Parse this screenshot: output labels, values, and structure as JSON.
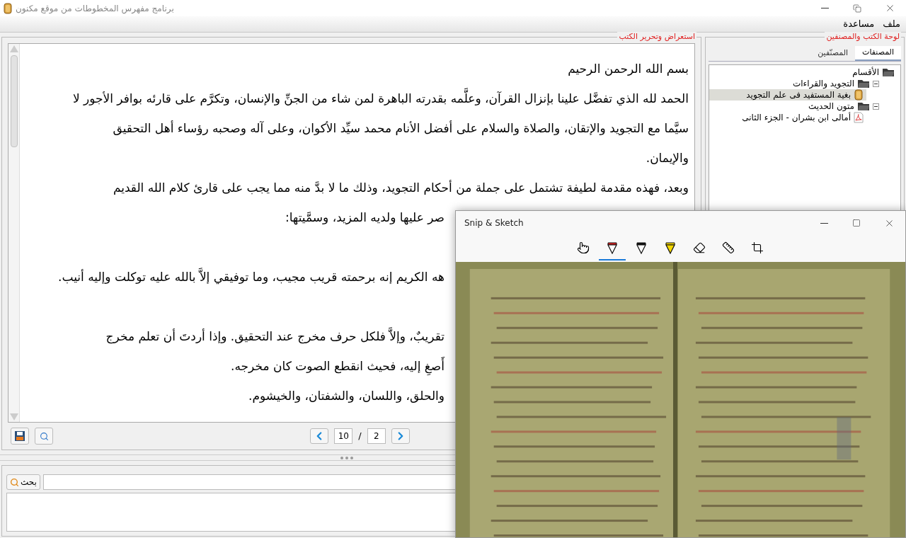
{
  "window": {
    "title": "برنامج مفهرس المخطوطات من موقع مكنون"
  },
  "menu": [
    "ملف",
    "مساعدة"
  ],
  "editor": {
    "title": "استعراض وتحرير الكتب",
    "lines": [
      {
        "kind": "line",
        "text": "بسم الله الرحمن الرحيم"
      },
      {
        "kind": "line",
        "text": "الحمد لله الذي تفضَّل علينا بإنزال القرآن، وعلَّمه بقدرته الباهرة لمن شاء من الجنِّ والإنسان، وتكرَّم على قارئه بوافر الأجور لا"
      },
      {
        "kind": "line",
        "text": "سيَّما مع التجويد والإتقان، والصلاة والسلام على أفضل الأنام محمد سيِّد الأكوان، وعلى آله وصحبه رؤساء أهل التحقيق"
      },
      {
        "kind": "line",
        "text": "والإيمان."
      },
      {
        "kind": "line",
        "text": "وبعد، فهذه مقدمة لطيفة تشتمل على جملة من أحكام التجويد، وذلك ما لا بدَّ منه مما يجب على قارئ كلام الله القديم"
      },
      {
        "kind": "partial",
        "text": "صر عليها ولديه المزيد، وسمَّيتها:"
      },
      {
        "kind": "blank"
      },
      {
        "kind": "partial",
        "text": "هه الكريم إنه برحمته قريب مجيب، وما توفيقي إلاَّ بالله عليه توكلت وإليه أنيب."
      },
      {
        "kind": "blank"
      },
      {
        "kind": "partial",
        "text": "تقريبٌ، وإلاَّ فلكل حرف مخرج عند التحقيق. وإذا أردتَ أن تعلم مخرج"
      },
      {
        "kind": "partial",
        "text": "أَصغِ إليه، فحيث انقطع الصوت كان مخرجه."
      },
      {
        "kind": "partial",
        "text": "والحلق، واللسان، والشفتان، والخيشوم."
      }
    ]
  },
  "pager": {
    "current": "10",
    "separator": "/",
    "total": "2"
  },
  "search": {
    "button": "بحث"
  },
  "library": {
    "title": "لوحة الكتب والمصنفين",
    "tabs": [
      {
        "label": "المصنفات",
        "selected": true
      },
      {
        "label": "المصنّفين",
        "selected": false
      }
    ],
    "tree": [
      {
        "label": "الأقسام",
        "kind": "folder",
        "selected": false,
        "children": [
          {
            "label": "التجويد والقراءات",
            "kind": "folder",
            "expanded": true,
            "selected": false,
            "children": [
              {
                "label": "بغية المستفيد فى علم التجويد",
                "kind": "book",
                "selected": true
              }
            ]
          },
          {
            "label": "متون الحديث",
            "kind": "folder",
            "expanded": true,
            "selected": false,
            "children": [
              {
                "label": "أمالى ابن بشران - الجزء الثانى",
                "kind": "pdf",
                "selected": false
              }
            ]
          }
        ]
      }
    ]
  },
  "snip_window": {
    "title": "Snip & Sketch",
    "tools": [
      {
        "kind": "touch",
        "selected": false
      },
      {
        "kind": "pen",
        "selected": true
      },
      {
        "kind": "pencil",
        "selected": false
      },
      {
        "kind": "highlighter",
        "selected": false
      },
      {
        "kind": "eraser",
        "selected": false
      },
      {
        "kind": "ruler",
        "selected": false
      },
      {
        "kind": "crop",
        "selected": false
      }
    ]
  }
}
